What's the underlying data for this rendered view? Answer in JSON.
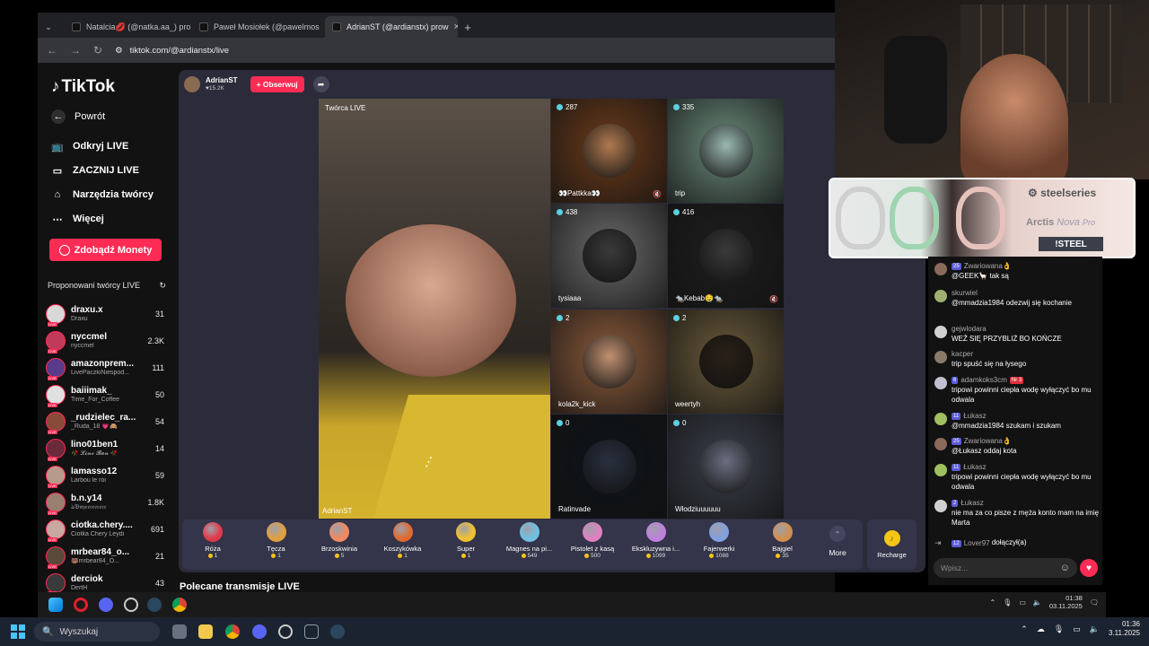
{
  "browser": {
    "tabs": [
      {
        "title": "Natalcia💋 (@natka.aa_) prow"
      },
      {
        "title": "Paweł Mosiołek (@pawelmosio"
      },
      {
        "title": "AdrianST (@ardianstx) prow"
      }
    ],
    "url": "tiktok.com/@ardianstx/live"
  },
  "sidebar": {
    "logo": "TikTok",
    "nav": [
      {
        "label": "Powrót",
        "icon": "back-arrow-icon"
      },
      {
        "label": "Odkryj LIVE",
        "icon": "tv-icon"
      },
      {
        "label": "ZACZNIJ LIVE",
        "icon": "camera-icon"
      },
      {
        "label": "Narzędzia twórcy",
        "icon": "home-tools-icon"
      },
      {
        "label": "Więcej",
        "icon": "more-dots-icon"
      }
    ],
    "coins_button": "Zdobądź Monety",
    "suggested_title": "Proponowani twórcy LIVE",
    "creators": [
      {
        "name": "draxu.x",
        "sub": "Draxu",
        "count": "31",
        "color": "#d8d8d8"
      },
      {
        "name": "nyccmel",
        "sub": "nyccmel",
        "count": "2.3K",
        "color": "#c23a5a"
      },
      {
        "name": "amazonprem...",
        "sub": "LivePaczkiNiespod...",
        "count": "111",
        "color": "#5a3a8a"
      },
      {
        "name": "baiiimak_",
        "sub": "Time_For_Coffee",
        "count": "50",
        "color": "#e0e0e0"
      },
      {
        "name": "_rudzielec_ra...",
        "sub": "_Ruda_18 💗🙈",
        "count": "54",
        "color": "#8a4a3a"
      },
      {
        "name": "lino01ben1",
        "sub": "🥀 𝓛𝓲𝓷𝓸 𝓑𝓮𝓷 🥀",
        "count": "14",
        "color": "#6a2a3a"
      },
      {
        "name": "lamasso12",
        "sub": "Larbou le roi",
        "count": "59",
        "color": "#b89a8a"
      },
      {
        "name": "b.n.y14",
        "sub": "ঌ𝔅𝔫𝔶𝔢𝔢𝔢𝔢𝔢𝔢𝔢𝔢𝔢",
        "count": "1.8K",
        "color": "#9a8070"
      },
      {
        "name": "ciotka.chery....",
        "sub": "Ciotka Chery Leydi",
        "count": "691",
        "color": "#c8a8a0"
      },
      {
        "name": "mrbear84_o...",
        "sub": "🐻mrbear84_O...",
        "count": "21",
        "color": "#5a4a3a"
      },
      {
        "name": "derciok",
        "sub": "DertH",
        "count": "43",
        "color": "#3a3a3a"
      }
    ]
  },
  "live": {
    "host_name": "AdrianST",
    "host_likes": "♥15.2K",
    "follow_label": "+ Obserwuj",
    "main_label": "Twórca LIVE",
    "main_name": "AdrianST",
    "tiles": [
      {
        "count": "287",
        "label": "👀Pattkka👀",
        "bg": "#6a3a1a",
        "circle": "#b07a50",
        "muted": true
      },
      {
        "count": "335",
        "label": "trip",
        "bg": "#6a8a7a",
        "circle": "#9ab8b0",
        "muted": false
      },
      {
        "count": "438",
        "label": "tysiaaa",
        "bg": "#6a6a6a",
        "circle": "#3a3a3a",
        "muted": false
      },
      {
        "count": "416",
        "label": "🐀Kebab🤤🐀",
        "bg": "#1e1e1e",
        "circle": "#3a3a3a",
        "muted": true
      },
      {
        "count": "2",
        "label": "kola2k_kick",
        "bg": "#8a5a3a",
        "circle": "#c09070",
        "muted": false
      },
      {
        "count": "2",
        "label": "weertyh",
        "bg": "#6a5a3a",
        "circle": "#2a2018",
        "muted": false
      },
      {
        "count": "0",
        "label": "Ratinvade",
        "bg": "#0e1218",
        "circle": "#2a3040",
        "muted": false
      },
      {
        "count": "0",
        "label": "Włodziuuuuuu",
        "bg": "#3a3e4a",
        "circle": "#6a6e80",
        "muted": false
      }
    ]
  },
  "gifts": [
    {
      "name": "Róża",
      "price": "1",
      "color": "#e03a4a"
    },
    {
      "name": "Tęcza",
      "price": "1",
      "color": "#e0a040"
    },
    {
      "name": "Brzoskwinia",
      "price": "5",
      "color": "#f08a60"
    },
    {
      "name": "Koszykówka",
      "price": "1",
      "color": "#e06a30"
    },
    {
      "name": "Super",
      "price": "1",
      "color": "#f0c030"
    },
    {
      "name": "Magnes na pi...",
      "price": "549",
      "color": "#70c0e0"
    },
    {
      "name": "Pistolet z kasą",
      "price": "500",
      "color": "#e080c0"
    },
    {
      "name": "Ekskluzywna i...",
      "price": "1099",
      "color": "#c080e0"
    },
    {
      "name": "Fajerwerki",
      "price": "1088",
      "color": "#80a0e0"
    },
    {
      "name": "Bajgiel",
      "price": "35",
      "color": "#d09050"
    }
  ],
  "more_label": "More",
  "recharge_label": "Recharge",
  "recommended_title": "Polecane transmisje LIVE",
  "chat": {
    "messages": [
      {
        "user": "Zwariowana👌",
        "badge": "25",
        "text": "@GEEK🦙 tak są",
        "color": "#8a6a5a"
      },
      {
        "user": "skurwiel",
        "badge": "",
        "text": "@mmadzia1984 odezwij się kochanie",
        "color": "#a0b070"
      },
      {
        "user": "gejwlodara",
        "badge": "",
        "text": "WEŹ SIĘ PRZYBLIŻ BO KOŃCZE",
        "color": "#d0d0d0"
      },
      {
        "user": "kacper",
        "badge": "",
        "text": "trip spuść się na łysego",
        "color": "#8a7a6a"
      },
      {
        "user": "adamkoks3cm",
        "badge": "6",
        "badge2": "Nr 3",
        "text": "tripowi powinni ciepła wodę wyłączyć bo mu odwala",
        "color": "#c0c0d0"
      },
      {
        "user": "Łukasz",
        "badge": "11",
        "text": "@mmadzia1984 szukam i szukam",
        "color": "#a0c060"
      },
      {
        "user": "Zwariowana👌",
        "badge": "25",
        "text": "@Łukasz oddaj kota",
        "color": "#8a6a5a"
      },
      {
        "user": "Łukasz",
        "badge": "11",
        "text": "tripowi powinni ciepła wodę wyłączyć bo mu odwala",
        "color": "#a0c060"
      },
      {
        "user": "Łukasz",
        "badge": "2",
        "text": "nie ma za co pisze z męża konto mam na imię Marta",
        "color": "#d0d0d0"
      }
    ],
    "join_badge": "12",
    "join_user": "Lover97",
    "join_text": "dołączył(a)",
    "input_placeholder": "Wpisz..."
  },
  "ad": {
    "brand": "steelseries",
    "product": "Arctis",
    "product_em": "Nova",
    "product_sub": "Pro",
    "command": "!STEEL"
  },
  "inner_tray": {
    "time": "01:38",
    "date": "03.11.2025"
  },
  "taskbar": {
    "search": "Wyszukaj",
    "time": "01:36",
    "date": "3.11.2025"
  }
}
